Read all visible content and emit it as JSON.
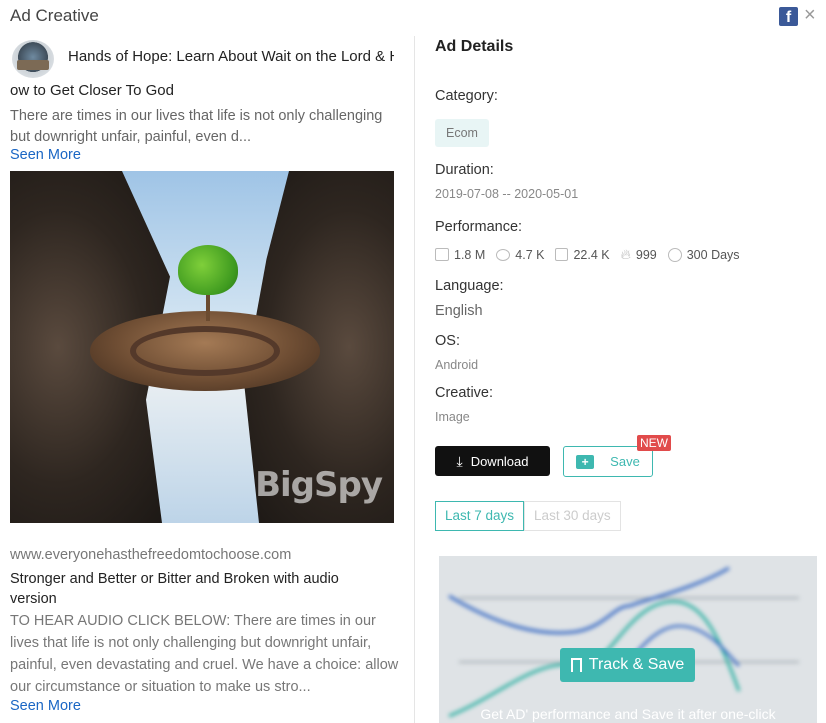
{
  "modal": {
    "title": "Ad Creative",
    "platform_icon": "facebook-icon",
    "close_glyph": "×"
  },
  "post": {
    "title_line1": "Hands of Hope: Learn About Wait on the Lord & H",
    "title_line2": "ow to Get Closer To God",
    "body": "There are times in our lives that life is not only challenging but downright unfair, painful, even d...",
    "seen_more": "Seen More",
    "image_watermark": "BigSpy"
  },
  "link": {
    "domain": "www.everyonehasthefreedomtochoose.com",
    "headline": "Stronger and Better or Bitter and Broken with audio version",
    "description": "TO HEAR AUDIO CLICK BELOW:   There are times in our lives that life is not only challenging but downright unfair, painful, even devastating and cruel. We have a choice: allow our circumstance or situation to make us stro...",
    "seen_more": "Seen More"
  },
  "details": {
    "title": "Ad Details",
    "category_label": "Category:",
    "category_value": "Ecom",
    "duration_label": "Duration:",
    "duration_value": "2019-07-08 -- 2020-05-01",
    "performance_label": "Performance:",
    "performance": {
      "likes": "1.8 M",
      "comments": "4.7 K",
      "shares": "22.4 K",
      "hot": "999",
      "days": "300 Days"
    },
    "language_label": "Language:",
    "language_value": "English",
    "os_label": "OS:",
    "os_value": "Android",
    "creative_label": "Creative:",
    "creative_value": "Image"
  },
  "actions": {
    "download": "Download",
    "save": "Save",
    "new_badge": "NEW"
  },
  "range_tabs": {
    "last7": "Last 7 days",
    "last30": "Last 30 days"
  },
  "chart_teaser": {
    "track_save": "Track & Save",
    "caption": "Get AD' performance and Save it after one-click"
  },
  "colors": {
    "accent": "#3eb8b0",
    "link": "#1a66c4",
    "badge": "#e14b4b",
    "facebook": "#3b5998"
  }
}
